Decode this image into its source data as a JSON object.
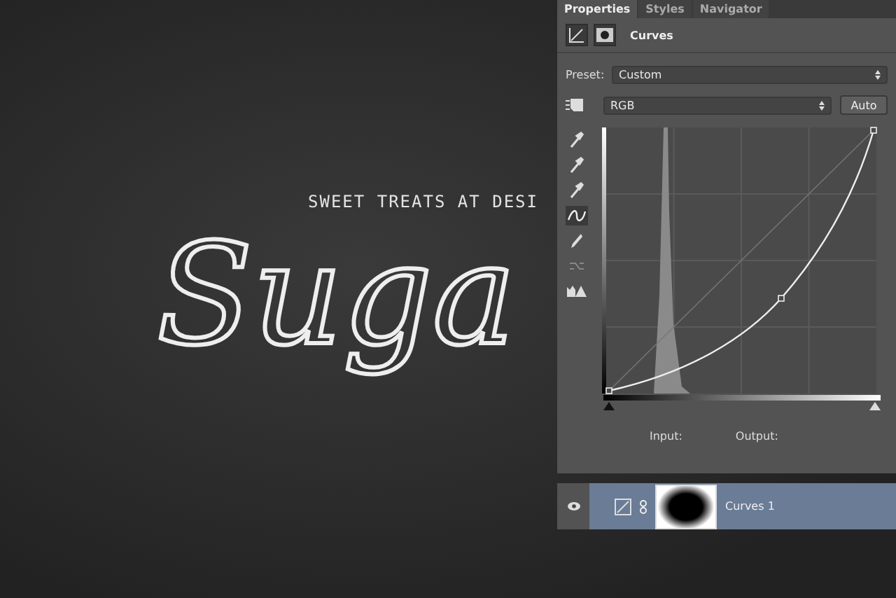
{
  "canvas": {
    "tagline": "SWEET TREATS AT DESI",
    "title": "Suga"
  },
  "panel": {
    "tabs": [
      {
        "label": "Properties",
        "selected": true
      },
      {
        "label": "Styles",
        "selected": false
      },
      {
        "label": "Navigator",
        "selected": false
      }
    ],
    "header": "Curves",
    "preset": {
      "label": "Preset:",
      "value": "Custom"
    },
    "channel": "RGB",
    "auto_button": "Auto",
    "tools": [
      {
        "kind": "eyedropper",
        "selected": false
      },
      {
        "kind": "eyedropper",
        "selected": false
      },
      {
        "kind": "eyedropper",
        "selected": false
      },
      {
        "kind": "curve",
        "selected": true
      },
      {
        "kind": "pencil",
        "selected": false
      },
      {
        "kind": "smooth",
        "selected": false
      },
      {
        "kind": "clipping",
        "selected": false
      }
    ],
    "input_sliders": [
      {
        "level": 0
      },
      {
        "level": 1
      }
    ],
    "input_label": "Input:",
    "output_label": "Output:"
  },
  "layers": [
    {
      "name": "Curves 1",
      "visible": true,
      "selected": true
    }
  ]
}
